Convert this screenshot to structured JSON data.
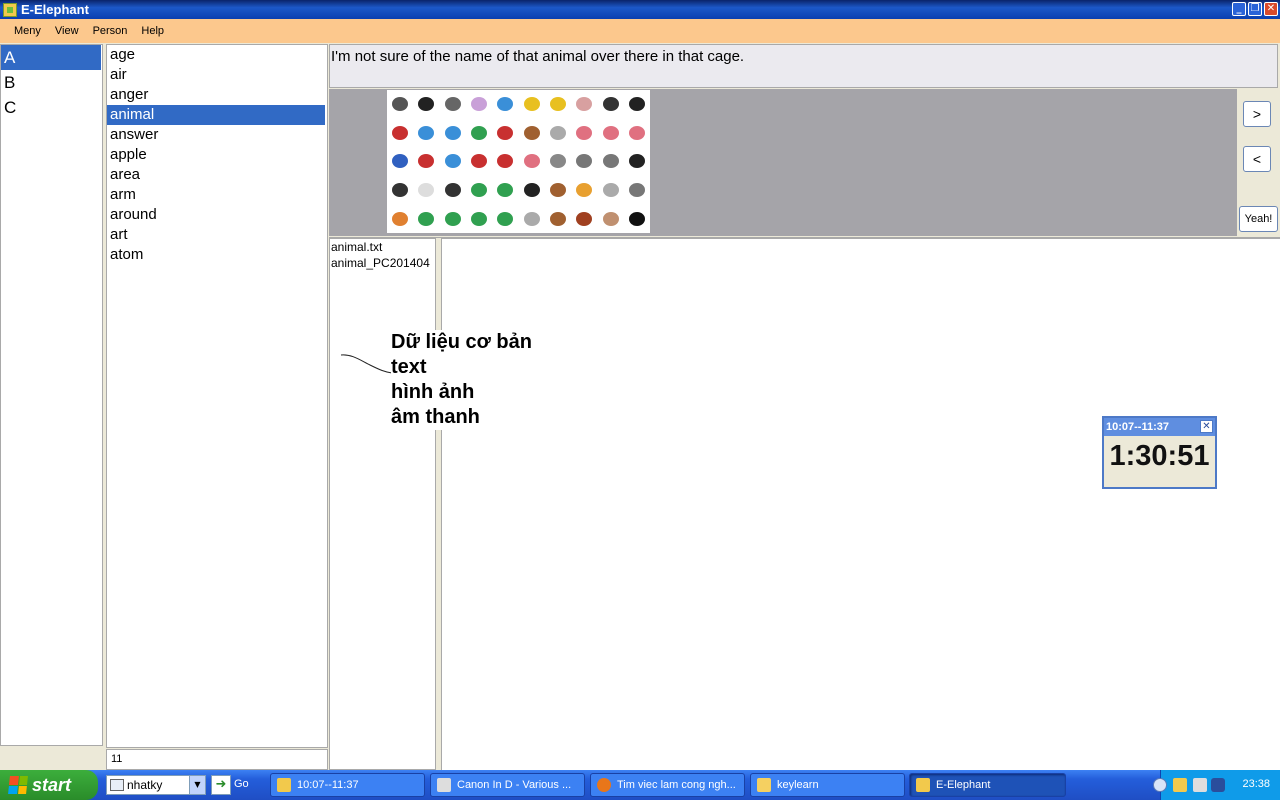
{
  "window": {
    "title": "E-Elephant"
  },
  "menu": [
    "Meny",
    "View",
    "Person",
    "Help"
  ],
  "letters": {
    "items": [
      "A",
      "B",
      "C"
    ],
    "selected": 0
  },
  "words": {
    "items": [
      "age",
      "air",
      "anger",
      "animal",
      "answer",
      "apple",
      "area",
      "arm",
      "around",
      "art",
      "atom"
    ],
    "selected": 3,
    "count": "11"
  },
  "sentence": "I'm not sure of the name of that animal over there in that cage.",
  "nav": {
    "next": ">",
    "prev": "<",
    "yeah": "Yeah!"
  },
  "files": [
    "animal.txt",
    "animal_PC201404"
  ],
  "annotation": [
    "Dữ liệu cơ bản",
    "text",
    "hình ảnh",
    "âm thanh"
  ],
  "timer": {
    "range": "10:07--11:37",
    "time": "1:30:51"
  },
  "taskbar": {
    "start": "start",
    "address": "nhatky",
    "go": "Go",
    "tasks": [
      "10:07--11:37",
      "Canon In D - Various ...",
      "Tim viec lam cong ngh...",
      "keylearn",
      "E-Elephant"
    ],
    "clock": "23:38"
  },
  "animal_colors": [
    "#555",
    "#222",
    "#666",
    "#c9a0d8",
    "#3a8fd8",
    "#e8c020",
    "#e8c020",
    "#d8a0a0",
    "#333",
    "#222",
    "#c83030",
    "#3a8fd8",
    "#3a8fd8",
    "#30a050",
    "#c83030",
    "#a06030",
    "#aaa",
    "#e07080",
    "#e07080",
    "#e07080",
    "#3060c0",
    "#c83030",
    "#3a8fd8",
    "#c83030",
    "#c83030",
    "#e07080",
    "#888",
    "#777",
    "#777",
    "#222",
    "#333",
    "#ddd",
    "#333",
    "#30a050",
    "#30a050",
    "#222",
    "#a06030",
    "#e8a030",
    "#aaa",
    "#777",
    "#e08030",
    "#30a050",
    "#30a050",
    "#30a050",
    "#30a050",
    "#aaa",
    "#a06030",
    "#a04020",
    "#c09070",
    "#111"
  ]
}
